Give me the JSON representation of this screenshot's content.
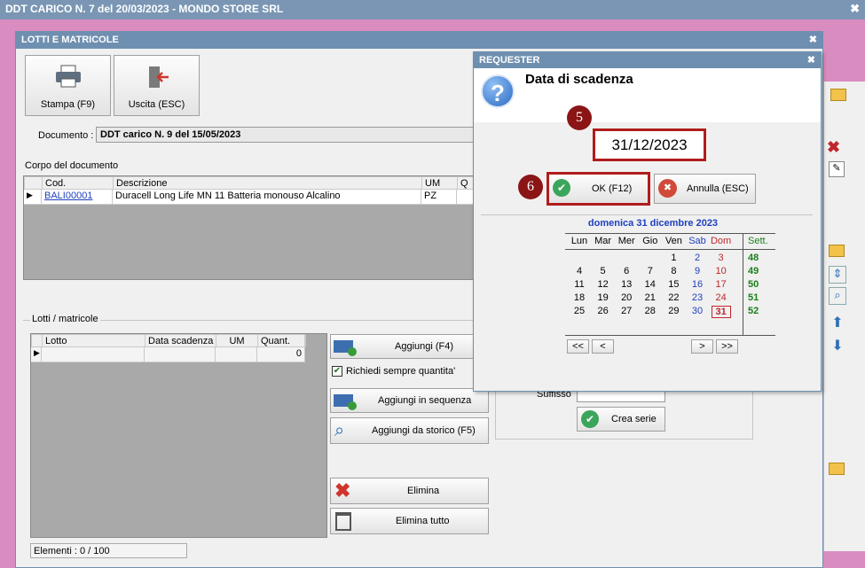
{
  "main_window": {
    "title": "DDT CARICO N. 7 del 20/03/2023 - MONDO STORE SRL"
  },
  "lotti_window": {
    "title": "LOTTI E MATRICOLE",
    "toolbar": {
      "print_label": "Stampa (F9)",
      "exit_label": "Uscita (ESC)"
    },
    "documento_label": "Documento :",
    "documento_value": "DDT carico N. 9 del 15/05/2023",
    "corpo_label": "Corpo del documento",
    "corpo_columns": [
      "Cod.",
      "Descrizione",
      "UM",
      "Q"
    ],
    "corpo_rows": [
      {
        "cod": "BALI00001",
        "descrizione": "Duracell Long Life MN 11 Batteria monouso Alcalino",
        "um": "PZ"
      }
    ],
    "lotti_label": "Lotti / matricole",
    "lotti_columns": [
      "Lotto",
      "Data scadenza",
      "UM",
      "Quant."
    ],
    "lotti_rows": [
      {
        "quant": "0"
      }
    ],
    "buttons": {
      "aggiungi": "Aggiungi (F4)",
      "richiedi": "Richiedi sempre quantita'",
      "aggiungi_sequenza": "Aggiungi in sequenza",
      "aggiungi_storico": "Aggiungi da storico (F5)",
      "elimina": "Elimina",
      "elimina_tutto": "Elimina tutto",
      "crea_serie": "Crea serie"
    },
    "suffisso_label": "Suffisso",
    "elementi": "Elementi : 0 / 100"
  },
  "requester": {
    "title": "REQUESTER",
    "heading": "Data di scadenza",
    "date_value": "31/12/2023",
    "ok_label": "OK (F12)",
    "cancel_label": "Annulla (ESC)",
    "marker_5": "5",
    "marker_6": "6",
    "calendar": {
      "header": "domenica 31 dicembre 2023",
      "days": [
        "Lun",
        "Mar",
        "Mer",
        "Gio",
        "Ven",
        "Sab",
        "Dom"
      ],
      "sett_label": "Sett.",
      "weeks": [
        {
          "days": [
            "",
            "",
            "",
            "",
            "1",
            "2",
            "3"
          ],
          "week": "48"
        },
        {
          "days": [
            "4",
            "5",
            "6",
            "7",
            "8",
            "9",
            "10"
          ],
          "week": "49"
        },
        {
          "days": [
            "11",
            "12",
            "13",
            "14",
            "15",
            "16",
            "17"
          ],
          "week": "50"
        },
        {
          "days": [
            "18",
            "19",
            "20",
            "21",
            "22",
            "23",
            "24"
          ],
          "week": "51"
        },
        {
          "days": [
            "25",
            "26",
            "27",
            "28",
            "29",
            "30",
            "31"
          ],
          "week": "52"
        }
      ],
      "nav": {
        "prev_year": "<<",
        "prev": "<",
        "next": ">",
        "next_year": ">>"
      },
      "selected_day": "31"
    }
  },
  "colors": {
    "accent_red": "#b01c1c",
    "blue_titlebar": "#6f8fb0",
    "week_green": "#1a7f1a"
  }
}
